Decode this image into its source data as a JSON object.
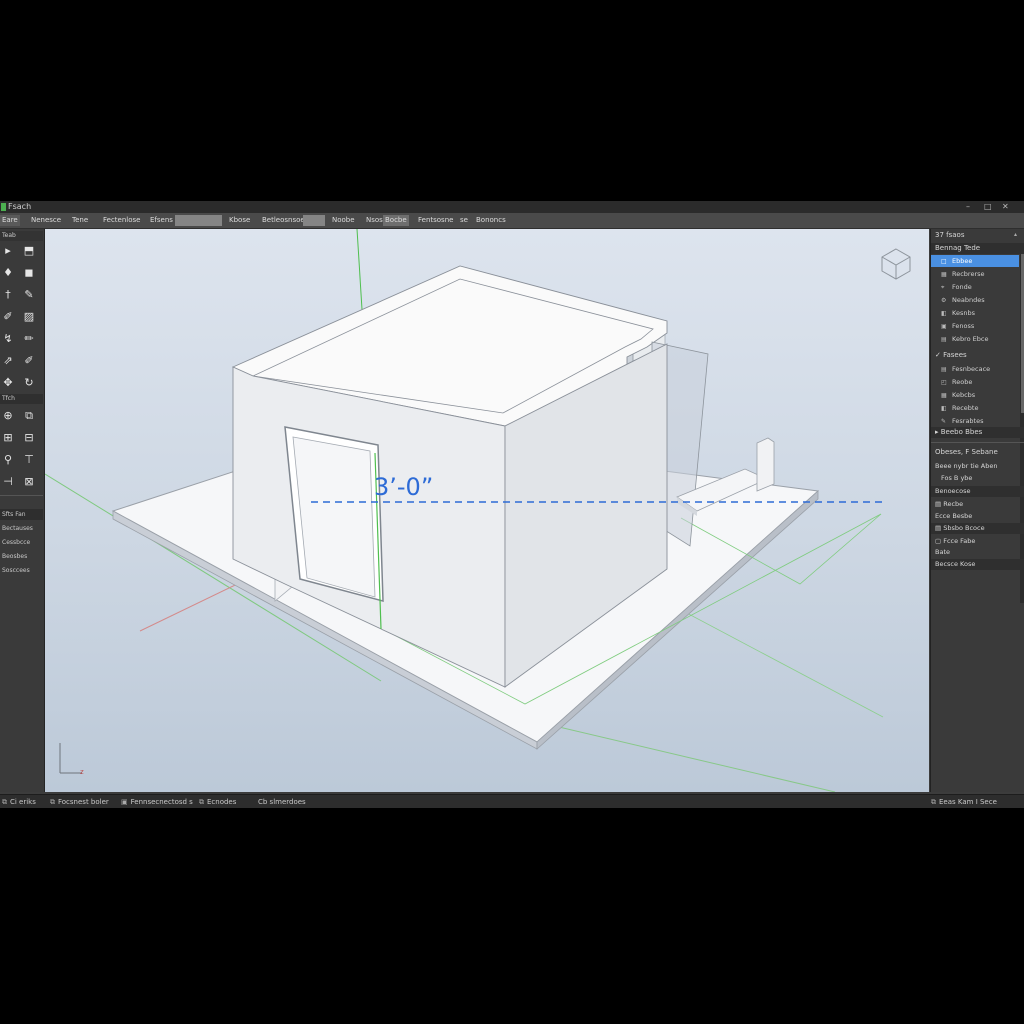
{
  "window": {
    "title": "Fsach",
    "controls": [
      "–",
      "□",
      "✕"
    ]
  },
  "menubar": {
    "items": [
      "Eare",
      "Nenesce",
      "Tene",
      "Fectenlose",
      "Efsens",
      "Kbose",
      "Betleosnsoe",
      "Noobe",
      "Nsos",
      "Bocbe",
      "Fentsosne",
      "se",
      "Bononcs"
    ],
    "selected": "Bocbe"
  },
  "toolbox": {
    "header": "Teab",
    "tools": [
      "pointer-icon",
      "cursor-icon",
      "paint-icon",
      "square-icon",
      "line-icon",
      "eraser-icon",
      "pen-icon",
      "brush-icon",
      "tape-icon",
      "pencil-icon",
      "push-icon",
      "orbit-icon",
      "move-icon",
      "rotate-icon",
      "rect-icon",
      "scale-icon",
      "text-icon",
      "grid-icon",
      "search-icon",
      "tee-icon",
      "dim-icon",
      "section-icon"
    ],
    "section2_header": "Tfch",
    "rows": [
      "Sfts Fan",
      "Bectauses",
      "Cessbcce",
      "Beosbes",
      "Sosccees"
    ]
  },
  "viewport": {
    "dimension_label": "3’-0”",
    "axis_label": "z"
  },
  "panel": {
    "header": "37 fsaos",
    "section1_title": "Bennag Tede",
    "section1_items": [
      {
        "label": "Ebbee",
        "icon": "□",
        "selected": true
      },
      {
        "label": "Recbrerse",
        "icon": "▦",
        "selected": false
      },
      {
        "label": "Fonde",
        "icon": "⌖",
        "selected": false
      },
      {
        "label": "Neabndes",
        "icon": "⚙",
        "selected": false
      },
      {
        "label": "Kesnbs",
        "icon": "◧",
        "selected": false
      },
      {
        "label": "Fenoss",
        "icon": "▣",
        "selected": false
      },
      {
        "label": "Kebro Ebce",
        "icon": "▤",
        "selected": false
      }
    ],
    "section2_title": "Fasees",
    "section2_items": [
      {
        "label": "Fesnbecace",
        "icon": "▤"
      },
      {
        "label": "Reobe",
        "icon": "◰"
      },
      {
        "label": "Kebcbs",
        "icon": "▦"
      },
      {
        "label": "Recebte",
        "icon": "◧"
      },
      {
        "label": "Fesrabtes",
        "icon": "✎"
      }
    ],
    "section3_title": "Beebo Bbes",
    "props_title": "Obeses, F Sebane",
    "props_rows": [
      "Beee nybr tie Aben",
      "Fos B ybe",
      "Benoecose",
      "Recbe",
      "Ecce Besbe",
      "Sbsbo Bcoce",
      "Fcce Fabe",
      "Bate",
      "Becsce Kose"
    ]
  },
  "statusbar": {
    "items": [
      {
        "icon": "⧉",
        "label": "Ci eriks"
      },
      {
        "icon": "⧉",
        "label": "Focsnest boler"
      },
      {
        "icon": "▣",
        "label": "Fennsecnectosd s"
      },
      {
        "icon": "⧉",
        "label": "Ecnodes"
      },
      {
        "icon": "",
        "label": "Cb slmerdoes"
      }
    ],
    "right": {
      "icon": "⧉",
      "label": "Eeas Kam I Sece"
    }
  }
}
